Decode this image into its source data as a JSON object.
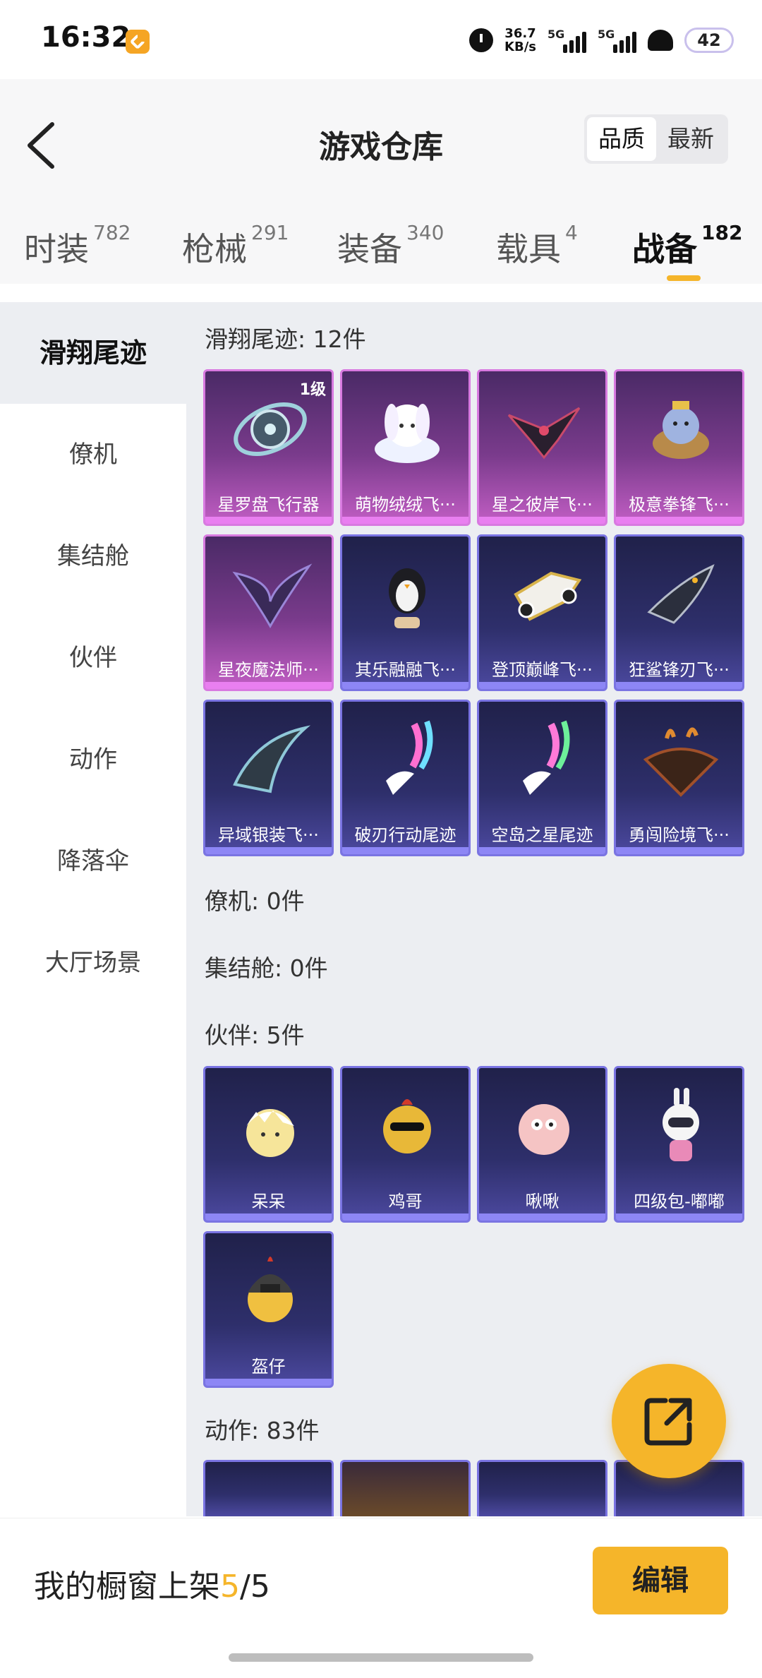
{
  "status_bar": {
    "time": "16:32",
    "net_speed_value": "36.7",
    "net_speed_unit": "KB/s",
    "sim1": "5G",
    "sim2": "5G",
    "battery": "42"
  },
  "header": {
    "title": "游戏仓库",
    "sort_quality": "品质",
    "sort_newest": "最新",
    "tabs": [
      {
        "label": "时装",
        "count": "782"
      },
      {
        "label": "枪械",
        "count": "291"
      },
      {
        "label": "装备",
        "count": "340"
      },
      {
        "label": "载具",
        "count": "4"
      },
      {
        "label": "战备",
        "count": "182"
      }
    ]
  },
  "sidebar": {
    "items": [
      {
        "label": "滑翔尾迹"
      },
      {
        "label": "僚机"
      },
      {
        "label": "集结舱"
      },
      {
        "label": "伙伴"
      },
      {
        "label": "动作"
      },
      {
        "label": "降落伞"
      },
      {
        "label": "大厅场景"
      }
    ]
  },
  "sections": {
    "glide": {
      "title": "滑翔尾迹: 12件",
      "items": [
        {
          "label": "星罗盘飞行器",
          "badge": "1级",
          "icon": "astrolabe-flyer-icon"
        },
        {
          "label": "萌物绒绒飞···",
          "icon": "plush-bunny-flyer-icon"
        },
        {
          "label": "星之彼岸飞···",
          "icon": "star-shore-flyer-icon"
        },
        {
          "label": "极意拳锋飞···",
          "icon": "elephant-fist-flyer-icon"
        },
        {
          "label": "星夜魔法师···",
          "icon": "starry-wings-icon"
        },
        {
          "label": "其乐融融飞···",
          "icon": "penguin-flyer-icon"
        },
        {
          "label": "登顶巅峰飞···",
          "icon": "summit-jet-icon"
        },
        {
          "label": "狂鲨锋刃飞···",
          "icon": "shark-blade-flyer-icon"
        },
        {
          "label": "异域银装飞···",
          "icon": "exotic-silver-flyer-icon"
        },
        {
          "label": "破刃行动尾迹",
          "icon": "rainbow-trail-icon"
        },
        {
          "label": "空岛之星尾迹",
          "icon": "rainbow-trail-icon"
        },
        {
          "label": "勇闯险境飞···",
          "icon": "rusty-wingsuit-icon"
        }
      ]
    },
    "wingman": {
      "title": "僚机: 0件"
    },
    "assembly": {
      "title": "集结舱: 0件"
    },
    "partner": {
      "title": "伙伴: 5件",
      "items": [
        {
          "label": "呆呆",
          "icon": "chick-eggshell-icon"
        },
        {
          "label": "鸡哥",
          "icon": "chicken-sunglasses-icon"
        },
        {
          "label": "啾啾",
          "icon": "pink-bird-icon"
        },
        {
          "label": "四级包-嘟嘟",
          "icon": "robot-bunny-icon"
        },
        {
          "label": "盔仔",
          "icon": "chick-helmet-icon"
        }
      ]
    },
    "action": {
      "title": "动作: 83件"
    }
  },
  "bottom_bar": {
    "text_prefix": "我的橱窗上架",
    "count_current": "5",
    "count_sep_total": "/5",
    "edit_label": "编辑"
  },
  "colors": {
    "accent": "#f5b52a",
    "card_pink": "#c25ec4",
    "card_blue": "#4c49a0"
  }
}
